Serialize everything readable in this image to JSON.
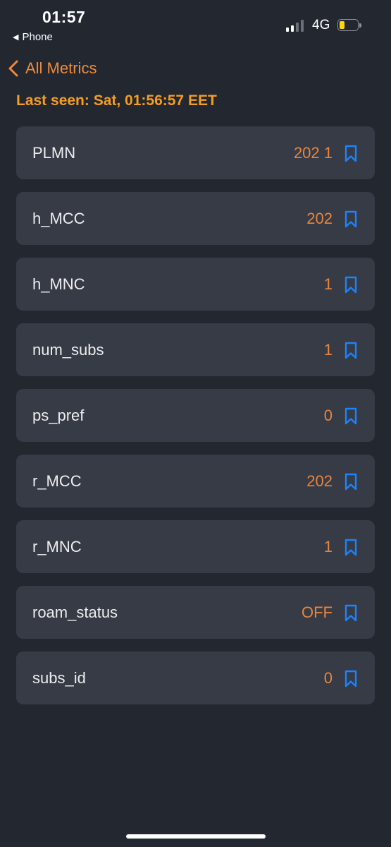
{
  "status_bar": {
    "time": "01:57",
    "back_app_label": "Phone",
    "network": "4G",
    "battery_level": 0.3,
    "signal_bars": 2
  },
  "nav": {
    "back_label": "All Metrics"
  },
  "last_seen": "Last seen: Sat, 01:56:57 EET",
  "colors": {
    "background": "#222730",
    "card": "#373b45",
    "accent_orange": "#ee8a3c",
    "last_seen": "#f59d1e",
    "bookmark_blue": "#1a84ff",
    "battery_yellow": "#ffd60a"
  },
  "metrics": [
    {
      "name": "PLMN",
      "value": "202 1",
      "icon": "bookmark-icon"
    },
    {
      "name": "h_MCC",
      "value": "202",
      "icon": "bookmark-icon"
    },
    {
      "name": "h_MNC",
      "value": "1",
      "icon": "bookmark-icon"
    },
    {
      "name": "num_subs",
      "value": "1",
      "icon": "bookmark-icon"
    },
    {
      "name": "ps_pref",
      "value": "0",
      "icon": "bookmark-icon"
    },
    {
      "name": "r_MCC",
      "value": "202",
      "icon": "bookmark-icon"
    },
    {
      "name": "r_MNC",
      "value": "1",
      "icon": "bookmark-icon"
    },
    {
      "name": "roam_status",
      "value": "OFF",
      "icon": "bookmark-icon"
    },
    {
      "name": "subs_id",
      "value": "0",
      "icon": "bookmark-icon"
    }
  ]
}
